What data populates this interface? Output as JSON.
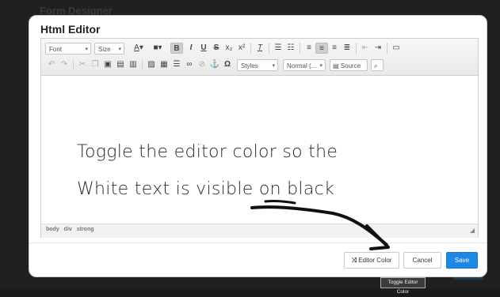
{
  "background": {
    "title": "Form Designer"
  },
  "modal": {
    "title": "Html Editor"
  },
  "toolbar": {
    "font": "Font",
    "size": "Size",
    "styles": "Styles",
    "format": "Normal (...",
    "source": "Source"
  },
  "content": {
    "annotation_line1": "Toggle the editor color so the",
    "annotation_line2": "White text is visible on black"
  },
  "statusbar": {
    "path": "body  div  strong"
  },
  "footer": {
    "toggle_label": "Editor Color",
    "cancel_label": "Cancel",
    "save_label": "Save"
  },
  "tooltip": "Toggle Editor Color",
  "colors": {
    "save": "#1e88e5",
    "overlay": "#1b1b1b"
  }
}
